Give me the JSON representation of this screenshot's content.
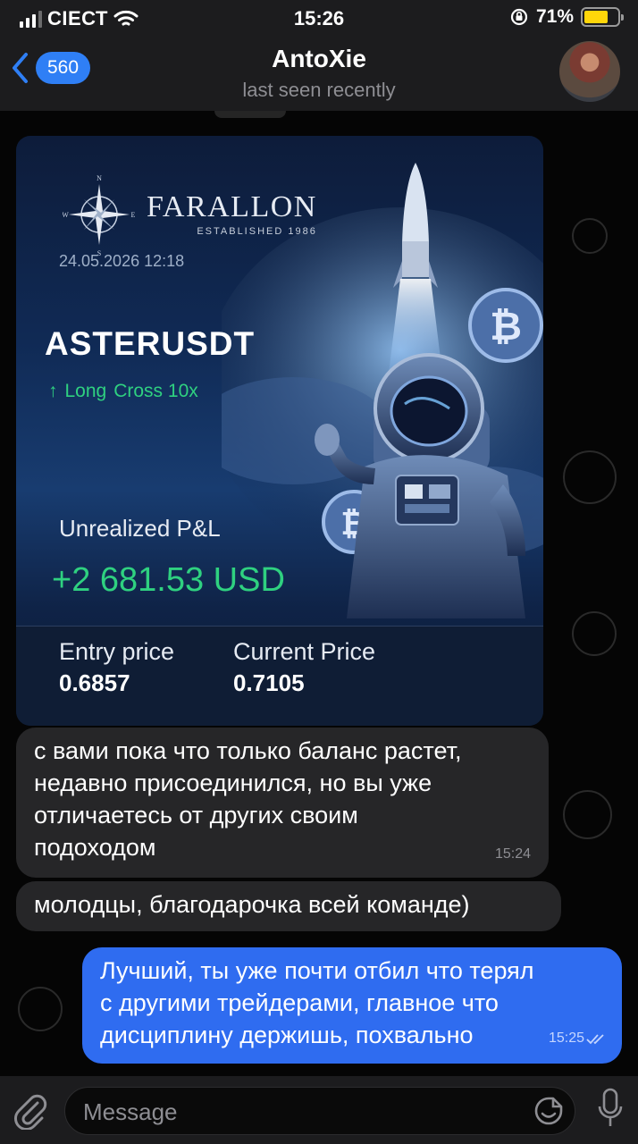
{
  "status_bar": {
    "carrier": "СIЕСТ",
    "time": "15:26",
    "battery": "71%",
    "battery_level": 0.71
  },
  "header": {
    "back_count": "560",
    "title": "AntoXie",
    "subtitle": "last seen recently"
  },
  "card": {
    "brand": "FARALLON",
    "established": "ESTABLISHED 1986",
    "compass_letters": [
      "N",
      "E",
      "S",
      "W"
    ],
    "datetime": "24.05.2026  12:18",
    "pair": "ASTERUSDT",
    "direction_arrow": "↑",
    "position": "Long",
    "margin": "Cross 10x",
    "pnl_label": "Unrealized P&L",
    "pnl_value": "+2 681.53 USD",
    "entry_label": "Entry price",
    "entry_value": "0.6857",
    "current_label": "Current Price",
    "current_value": "0.7105",
    "accent_green": "#2fd180"
  },
  "messages": [
    {
      "direction": "in",
      "text_lines": [
        "с вами пока что только баланс растет,",
        "недавно присоединился, но вы уже",
        "отличаетесь от других своим",
        "подоходом"
      ],
      "time": "15:24"
    },
    {
      "direction": "in",
      "text_lines": [
        "молодцы, благодарочка всей команде)"
      ]
    },
    {
      "direction": "out",
      "text_lines": [
        "Лучший, ты уже почти отбил что терял",
        "с другими трейдерами, главное что",
        "дисциплину держишь, похвально"
      ],
      "time": "15:25",
      "read": true
    }
  ],
  "input": {
    "placeholder": "Message"
  },
  "colors": {
    "outgoing_bubble": "#2f6cf0",
    "incoming_bubble": "#262628",
    "badge": "#2f7ff5"
  }
}
